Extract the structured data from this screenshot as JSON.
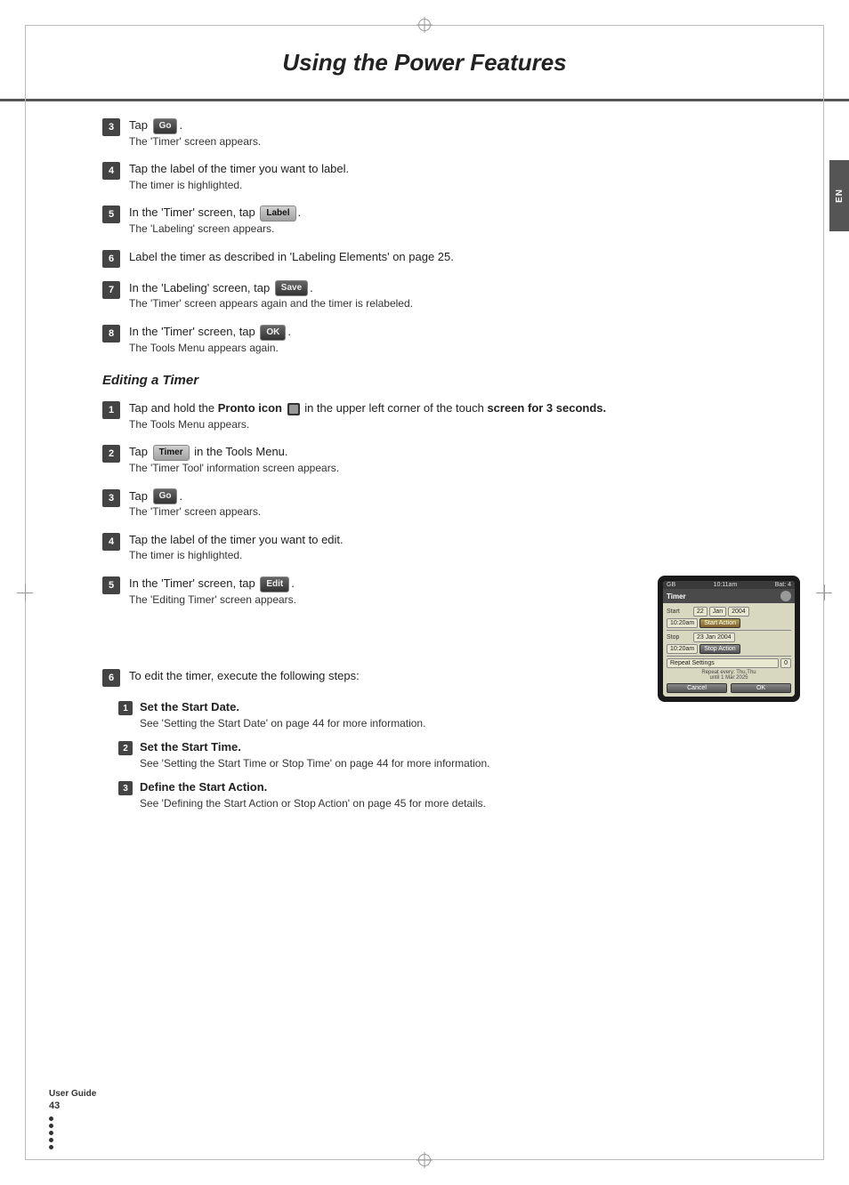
{
  "page": {
    "title": "Using the Power Features",
    "sidebar_tab": "EN",
    "footer": {
      "label": "User Guide",
      "page_number": "43"
    }
  },
  "steps_top": [
    {
      "num": "3",
      "main": "Tap [Go].",
      "sub": "The 'Timer' screen appears.",
      "has_button": true,
      "button_label": "Go"
    },
    {
      "num": "4",
      "main": "Tap the label of the timer you want to label.",
      "sub": "The timer is highlighted.",
      "has_button": false
    },
    {
      "num": "5",
      "main": "In the 'Timer' screen, tap [Label].",
      "sub": "The 'Labeling' screen appears.",
      "has_button": true,
      "button_label": "Label"
    },
    {
      "num": "6",
      "main": "Label the timer as described in 'Labeling Elements' on page 25.",
      "sub": "",
      "has_button": false
    },
    {
      "num": "7",
      "main": "In the 'Labeling' screen, tap [Save].",
      "sub": "The 'Timer' screen appears again and the timer is relabeled.",
      "has_button": true,
      "button_label": "Save"
    },
    {
      "num": "8",
      "main": "In the 'Timer' screen, tap [OK].",
      "sub": "The Tools Menu appears again.",
      "has_button": true,
      "button_label": "OK"
    }
  ],
  "section": {
    "title": "Editing a Timer"
  },
  "steps_editing": [
    {
      "num": "1",
      "main": "Tap and hold the Pronto icon  in the upper left corner of the touch screen for 3 seconds.",
      "main_bold": "Tap and hold the Pronto icon",
      "main_suffix": " in the upper left corner of the touch screen for 3 seconds.",
      "sub": "The Tools Menu appears.",
      "has_button": false
    },
    {
      "num": "2",
      "main": "Tap [Timer] in the Tools Menu.",
      "sub": "The 'Timer Tool' information screen appears.",
      "has_button": true,
      "button_label": "Timer"
    },
    {
      "num": "3",
      "main": "Tap [Go].",
      "sub": "The 'Timer' screen appears.",
      "has_button": true,
      "button_label": "Go"
    },
    {
      "num": "4",
      "main": "Tap the label of the timer you want to edit.",
      "sub": "The timer is highlighted.",
      "has_button": false
    },
    {
      "num": "5",
      "main": "In the 'Timer' screen, tap [Edit].",
      "sub": "The 'Editing Timer' screen appears.",
      "has_button": true,
      "button_label": "Edit"
    }
  ],
  "step6": {
    "num": "6",
    "main": "To edit the timer, execute the following steps:",
    "sub_steps": [
      {
        "num": "1",
        "main": "Set the Start Date.",
        "sub": "See 'Setting the Start Date' on page 44 for more information."
      },
      {
        "num": "2",
        "main": "Set the Start Time.",
        "sub": "See 'Setting the Start Time or Stop Time' on page 44 for more information."
      },
      {
        "num": "3",
        "main": "Define the Start Action.",
        "sub": "See 'Defining the Start Action or Stop Action' on page 45 for more details."
      }
    ]
  },
  "device": {
    "status_left": "GB",
    "status_middle": "10:11am",
    "status_right": "Bat: 4",
    "title": "Timer",
    "start_label": "Start",
    "start_day": "22",
    "start_month": "Jan",
    "start_year": "2004",
    "start_time": "10:20am",
    "start_action": "Start Action",
    "stop_label": "Stop",
    "stop_date": "23 Jan 2004",
    "stop_time": "10:20am",
    "stop_action": "Stop Action",
    "repeat_label": "Repeat Settings",
    "repeat_value": "0",
    "footer_text": "Repeat every: Thu,Thu",
    "footer_sub": "until 1 Mar 2025",
    "cancel_btn": "Cancel",
    "ok_btn": "OK"
  }
}
